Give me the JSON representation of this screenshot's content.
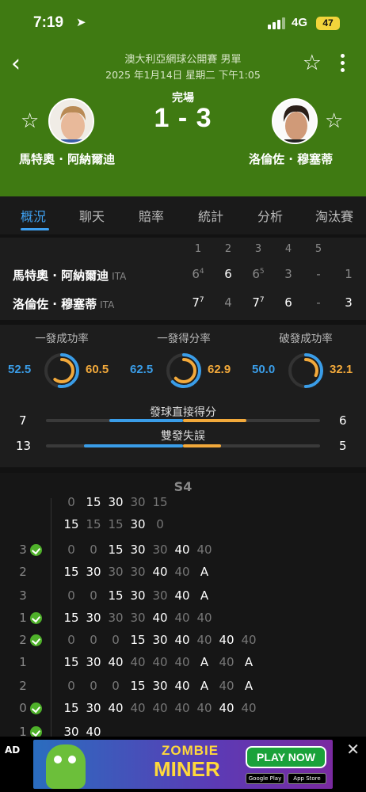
{
  "status_bar": {
    "time": "7:19",
    "network": "4G",
    "battery": "47"
  },
  "header": {
    "tournament": "澳大利亞網球公開賽 男單",
    "datetime": "2025 年1月14日 星期二 下午1:05",
    "match_status": "完場",
    "score": "1 - 3",
    "player1": "馬特奧 · 阿納爾迪",
    "player2": "洛倫佐 · 穆塞蒂"
  },
  "tabs": [
    "概況",
    "聊天",
    "賠率",
    "統計",
    "分析",
    "淘汰賽"
  ],
  "sets_table": {
    "headers": [
      "1",
      "2",
      "3",
      "4",
      "5"
    ],
    "rows": [
      {
        "name": "馬特奧 · 阿納爾迪",
        "country": "ITA",
        "sets": [
          "6",
          "6",
          "6",
          "3",
          "-"
        ],
        "tiebreaks": [
          "4",
          "",
          "5",
          "",
          ""
        ],
        "total": "1"
      },
      {
        "name": "洛倫佐 · 穆塞蒂",
        "country": "ITA",
        "sets": [
          "7",
          "4",
          "7",
          "6",
          "-"
        ],
        "tiebreaks": [
          "7",
          "",
          "7",
          "",
          ""
        ],
        "total": "3"
      }
    ]
  },
  "stats": {
    "circles": [
      {
        "label": "一發成功率",
        "left": "52.5",
        "right": "60.5"
      },
      {
        "label": "一發得分率",
        "left": "62.5",
        "right": "62.9"
      },
      {
        "label": "破發成功率",
        "left": "50.0",
        "right": "32.1"
      }
    ],
    "bars": [
      {
        "label": "發球直接得分",
        "left": "7",
        "right": "6",
        "left_frac": 0.54,
        "right_frac": 0.46
      },
      {
        "label": "雙發失誤",
        "left": "13",
        "right": "5",
        "left_frac": 0.72,
        "right_frac": 0.28
      }
    ],
    "colors": {
      "player1": "#3a9de8",
      "player2": "#f2a93b"
    }
  },
  "point_by_point": {
    "set_label": "S4",
    "games": [
      {
        "score1": "",
        "score2": "",
        "server": 0,
        "p1": [
          "0",
          "15",
          "30",
          "30",
          "15"
        ],
        "p1_hl": [
          0,
          1,
          1,
          0,
          0
        ],
        "p2": [
          "15",
          "15",
          "15",
          "30",
          "0"
        ],
        "p2_hl": [
          1,
          0,
          0,
          1,
          0
        ]
      },
      {
        "score1": "3",
        "score2": "2",
        "server": 1,
        "p1": [
          "0",
          "0",
          "15",
          "30",
          "30",
          "40",
          "40"
        ],
        "p1_hl": [
          0,
          0,
          1,
          1,
          0,
          1,
          0
        ],
        "p2": [
          "15",
          "30",
          "30",
          "30",
          "40",
          "40",
          "A"
        ],
        "p2_hl": [
          1,
          1,
          0,
          0,
          1,
          0,
          1
        ]
      },
      {
        "score1": "3",
        "score2": "1",
        "server": 2,
        "p1": [
          "0",
          "0",
          "15",
          "30",
          "30",
          "40",
          "A"
        ],
        "p1_hl": [
          0,
          0,
          1,
          1,
          0,
          1,
          1
        ],
        "p2": [
          "15",
          "30",
          "30",
          "30",
          "40",
          "40",
          "40"
        ],
        "p2_hl": [
          1,
          1,
          0,
          0,
          1,
          0,
          0
        ]
      },
      {
        "score1": "2",
        "score2": "1",
        "server": 1,
        "p1": [
          "0",
          "0",
          "0",
          "15",
          "30",
          "40",
          "40",
          "40",
          "40"
        ],
        "p1_hl": [
          0,
          0,
          0,
          1,
          1,
          1,
          0,
          1,
          0
        ],
        "p2": [
          "15",
          "30",
          "40",
          "40",
          "40",
          "40",
          "A",
          "40",
          "A"
        ],
        "p2_hl": [
          1,
          1,
          1,
          0,
          0,
          0,
          1,
          0,
          1
        ]
      },
      {
        "score1": "2",
        "score2": "0",
        "server": 2,
        "p1": [
          "0",
          "0",
          "0",
          "15",
          "30",
          "40",
          "A",
          "40",
          "A"
        ],
        "p1_hl": [
          0,
          0,
          0,
          1,
          1,
          1,
          1,
          0,
          1
        ],
        "p2": [
          "15",
          "30",
          "40",
          "40",
          "40",
          "40",
          "40",
          "40",
          "40"
        ],
        "p2_hl": [
          1,
          1,
          1,
          0,
          0,
          0,
          0,
          1,
          0
        ]
      },
      {
        "score1": "1",
        "score2": "",
        "server": 1,
        "p1": [
          "30",
          "40"
        ],
        "p1_hl": [
          1,
          1
        ],
        "p2": [],
        "p2_hl": []
      }
    ]
  },
  "ad": {
    "tag": "AD",
    "title1": "ZOMBIE",
    "title2": "MINER",
    "cta": "PLAY NOW",
    "store1": "Google Play",
    "store2": "App Store"
  }
}
